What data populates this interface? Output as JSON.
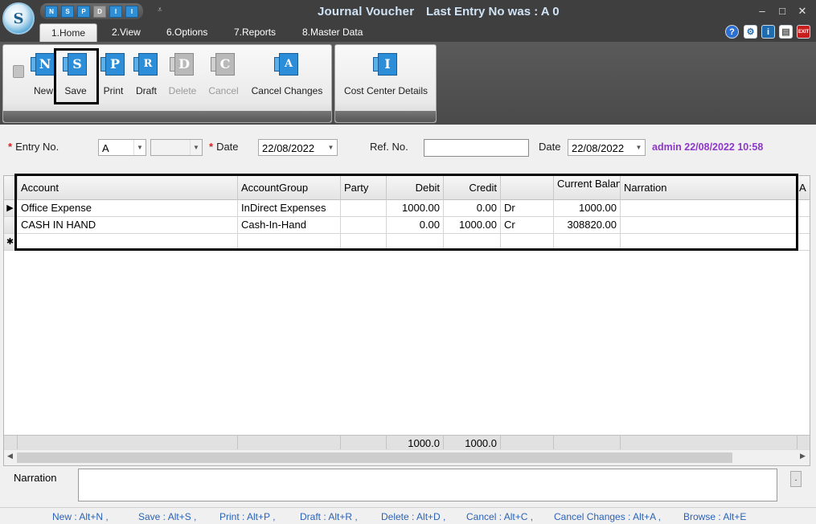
{
  "window": {
    "title": "Journal Voucher",
    "last_entry": "Last Entry No was : A 0",
    "orb_letter": "S",
    "controls": {
      "minimize": "–",
      "restore": "□",
      "close": "✕"
    }
  },
  "quick_access": [
    {
      "label": "N",
      "enabled": true
    },
    {
      "label": "S",
      "enabled": true
    },
    {
      "label": "P",
      "enabled": true
    },
    {
      "label": "D",
      "enabled": false
    },
    {
      "label": "I",
      "enabled": true
    },
    {
      "label": "I",
      "enabled": true
    }
  ],
  "quick_access_more": "⩡",
  "tabs": [
    {
      "label": "1.Home",
      "active": true
    },
    {
      "label": "2.View",
      "active": false
    },
    {
      "label": "6.Options",
      "active": false
    },
    {
      "label": "7.Reports",
      "active": false
    },
    {
      "label": "8.Master Data",
      "active": false
    }
  ],
  "help_icons": [
    {
      "name": "help-icon",
      "glyph": "?",
      "color": "#2a6fd1"
    },
    {
      "name": "settings-icon",
      "glyph": "⚙",
      "color": "#1f6bb0"
    },
    {
      "name": "info-icon",
      "glyph": "i",
      "color": "#1f6bb0"
    },
    {
      "name": "document-icon",
      "glyph": "▤",
      "color": "#555555"
    },
    {
      "name": "exit-icon",
      "glyph": "EXIT",
      "color": "#c81e1e"
    }
  ],
  "ribbon": {
    "buttons": [
      {
        "letter": "N",
        "label": "New",
        "enabled": true
      },
      {
        "letter": "S",
        "label": "Save",
        "enabled": true
      },
      {
        "letter": "P",
        "label": "Print",
        "enabled": true
      },
      {
        "letter": "R",
        "label": "Draft",
        "enabled": true
      },
      {
        "letter": "D",
        "label": "Delete",
        "enabled": false
      },
      {
        "letter": "C",
        "label": "Cancel",
        "enabled": false
      },
      {
        "letter": "A",
        "label": "Cancel Changes",
        "enabled": true
      }
    ],
    "cost_center": {
      "letter": "I",
      "label": "Cost Center Details"
    }
  },
  "form": {
    "entry_no_label": "Entry No.",
    "entry_no_prefix": "A",
    "entry_no_value": "",
    "date_label": "Date",
    "date_value": "22/08/2022",
    "ref_no_label": "Ref. No.",
    "ref_no_value": "",
    "ref_date_label": "Date",
    "ref_date_value": "22/08/2022",
    "admin_info": "admin 22/08/2022 10:58",
    "required_mark": "*"
  },
  "grid": {
    "columns": [
      "Account",
      "AccountGroup",
      "Party",
      "Debit",
      "Credit",
      "",
      "Current Balance",
      "Narration",
      "A"
    ],
    "rows": [
      {
        "marker": "▶",
        "account": "Office Expense",
        "group": "InDirect Expenses",
        "party": "",
        "debit": "1000.00",
        "credit": "0.00",
        "drcr": "Dr",
        "balance": "1000.00",
        "narration": ""
      },
      {
        "marker": "",
        "account": "CASH IN HAND",
        "group": "Cash-In-Hand",
        "party": "",
        "debit": "0.00",
        "credit": "1000.00",
        "drcr": "Cr",
        "balance": "308820.00",
        "narration": ""
      }
    ],
    "new_row_marker": "✱",
    "totals": {
      "debit": "1000.0",
      "credit": "1000.0"
    }
  },
  "narration": {
    "label": "Narration",
    "value": "",
    "button": "."
  },
  "shortcuts": [
    "New : Alt+N ,",
    "Save : Alt+S ,",
    "Print : Alt+P ,",
    "Draft : Alt+R ,",
    "Delete : Alt+D ,",
    "Cancel : Alt+C ,",
    "Cancel Changes : Alt+A ,",
    "Browse : Alt+E"
  ]
}
